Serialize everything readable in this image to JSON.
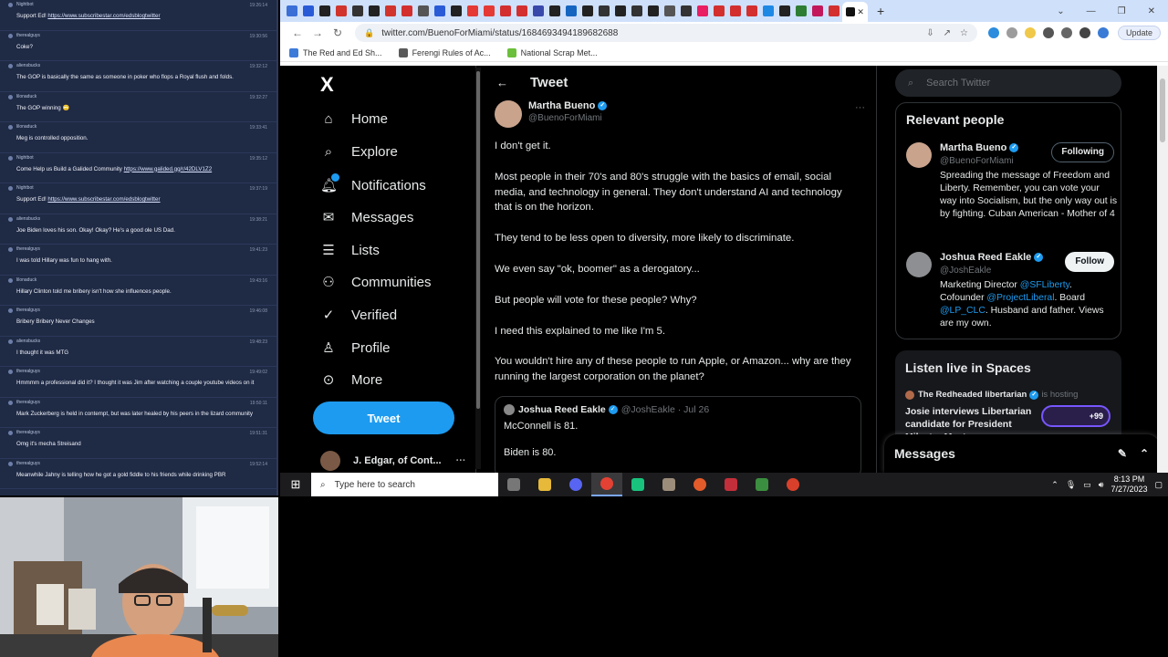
{
  "chat": [
    {
      "user": "Nightbot",
      "time": "19:26:14",
      "text": "Support Ed! https://www.subscribestar.com/edsblogtwitter"
    },
    {
      "user": "therealguys",
      "time": "19:30:56",
      "text": "Coke?"
    },
    {
      "user": "aliensbucks",
      "time": "19:32:12",
      "text": "The GOP is basically the same as someone in poker who flops a Royal flush and folds."
    },
    {
      "user": "lilonaduck",
      "time": "19:32:27",
      "text": "The GOP winning 🙄"
    },
    {
      "user": "lilonaduck",
      "time": "19:33:41",
      "text": "Meg is controlled opposition."
    },
    {
      "user": "Nightbot",
      "time": "19:35:12",
      "text": "Come Help us Build a Galided Community https://www.galided.gg/r/42DLV1Z2"
    },
    {
      "user": "Nightbot",
      "time": "19:37:19",
      "text": "Support Ed! https://www.subscribestar.com/edsblogtwitter"
    },
    {
      "user": "aliensbucks",
      "time": "19:38:21",
      "text": "Joe Biden loves his son. Okay! Okay? He's a good ole US Dad."
    },
    {
      "user": "therealguys",
      "time": "19:41:23",
      "text": "I was told Hillary was fun to hang with."
    },
    {
      "user": "lilonaduck",
      "time": "19:43:16",
      "text": "Hillary Clinton told me bribery isn't how she influences people."
    },
    {
      "user": "therealguys",
      "time": "19:46:08",
      "text": "Bribery Bribery Never Changes"
    },
    {
      "user": "aliensbucks",
      "time": "19:48:23",
      "text": "I thought it was MTG"
    },
    {
      "user": "therealguys",
      "time": "19:49:02",
      "text": "Hmmmm a professional did it? I thought it was Jim after watching a couple youtube videos on it"
    },
    {
      "user": "therealguys",
      "time": "19:50:11",
      "text": "Mark Zuckerberg is held in contempt, but was later healed by his peers in the lizard community"
    },
    {
      "user": "therealguys",
      "time": "19:51:31",
      "text": "Omg it's mecha Streisand"
    },
    {
      "user": "therealguys",
      "time": "19:52:14",
      "text": "Meanwhile Jahny is telling how he got a gold fiddle to his friends while drinking PBR"
    }
  ],
  "browser": {
    "url": "twitter.com/BuenoForMiami/status/1684693494189682688",
    "update_label": "Update",
    "bookmarks": [
      "The Red and Ed Sh...",
      "Ferengi Rules of Ac...",
      "National Scrap Met..."
    ]
  },
  "twitter": {
    "logo": "X",
    "nav": [
      "Home",
      "Explore",
      "Notifications",
      "Messages",
      "Lists",
      "Communities",
      "Verified",
      "Profile",
      "More"
    ],
    "tweet_button": "Tweet",
    "profile_name": "J. Edgar, of Cont...",
    "header_title": "Tweet",
    "author_name": "Martha Bueno",
    "author_handle": "@BuenoForMiami",
    "tweet_paragraphs": [
      "I don't get it.",
      "Most people in their 70's and 80's struggle with the basics of email, social media, and technology in general. They don't understand AI and technology that is on the horizon.",
      "They tend to be less open to diversity, more likely to discriminate.",
      "We even say \"ok, boomer\" as a derogatory...",
      "But people will vote for these people? Why?",
      "I need this explained to me like I'm 5.",
      "You wouldn't hire any of these people to run Apple, or Amazon... why are they running the largest corporation on the planet?"
    ],
    "quote": {
      "name": "Joshua Reed Eakle",
      "meta": "@JoshEakle · Jul 26",
      "line1": "McConnell is 81.",
      "line2": "Biden is 80."
    },
    "search_placeholder": "Search Twitter",
    "relevant_title": "Relevant people",
    "people": [
      {
        "name": "Martha Bueno",
        "handle": "@BuenoForMiami",
        "button": "Following",
        "bio": "Spreading the message of Freedom and Liberty. Remember, you can vote your way into Socialism, but the only way out is by fighting. Cuban American - Mother of 4"
      },
      {
        "name": "Joshua Reed Eakle",
        "handle": "@JoshEakle",
        "button": "Follow",
        "bio_a": "Marketing Director ",
        "bio_link1": "@SFLiberty",
        "bio_b": ". Cofounder ",
        "bio_link2": "@ProjectLiberal",
        "bio_c": ". Board ",
        "bio_link3": "@LP_CLC",
        "bio_d": ". Husband and father. Views are my own."
      }
    ],
    "spaces_title": "Listen live in Spaces",
    "spaces_host": "The Redheaded libertarian",
    "spaces_is_hosting": "is hosting",
    "spaces_topic": "Josie interviews Libertarian candidate for President Mike ter Maat",
    "spaces_count": "+99",
    "messages_label": "Messages"
  },
  "taskbar": {
    "search_placeholder": "Type here to search",
    "time": "8:13 PM",
    "date": "7/27/2023"
  }
}
